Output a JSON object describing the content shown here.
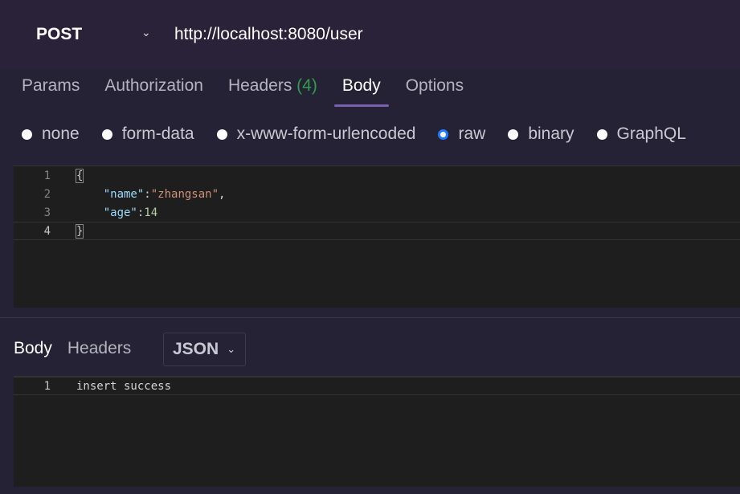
{
  "request": {
    "method": "POST",
    "url": "http://localhost:8080/user"
  },
  "tabs": [
    {
      "label": "Params"
    },
    {
      "label": "Authorization"
    },
    {
      "label": "Headers",
      "count": "(4)"
    },
    {
      "label": "Body"
    },
    {
      "label": "Options"
    }
  ],
  "body_types": [
    {
      "label": "none"
    },
    {
      "label": "form-data"
    },
    {
      "label": "x-www-form-urlencoded"
    },
    {
      "label": "raw",
      "selected": true
    },
    {
      "label": "binary"
    },
    {
      "label": "GraphQL"
    }
  ],
  "request_body": {
    "lines": [
      {
        "n": "1",
        "parts": [
          {
            "t": "{",
            "c": "p"
          }
        ]
      },
      {
        "n": "2",
        "parts": [
          {
            "t": "    \"name\"",
            "c": "k"
          },
          {
            "t": ":",
            "c": "p"
          },
          {
            "t": "\"zhangsan\"",
            "c": "s"
          },
          {
            "t": ",",
            "c": "p"
          }
        ]
      },
      {
        "n": "3",
        "parts": [
          {
            "t": "    \"age\"",
            "c": "k"
          },
          {
            "t": ":",
            "c": "p"
          },
          {
            "t": "14",
            "c": "n"
          }
        ]
      },
      {
        "n": "4",
        "parts": [
          {
            "t": "}",
            "c": "p"
          }
        ]
      }
    ]
  },
  "response": {
    "tabs": [
      {
        "label": "Body"
      },
      {
        "label": "Headers"
      }
    ],
    "format": "JSON",
    "lines": [
      {
        "n": "1",
        "text": "insert success"
      }
    ]
  },
  "colors": {
    "accent": "#7a5fb0",
    "radio_selected": "#1e7bff",
    "count_green": "#2e9e4a"
  }
}
